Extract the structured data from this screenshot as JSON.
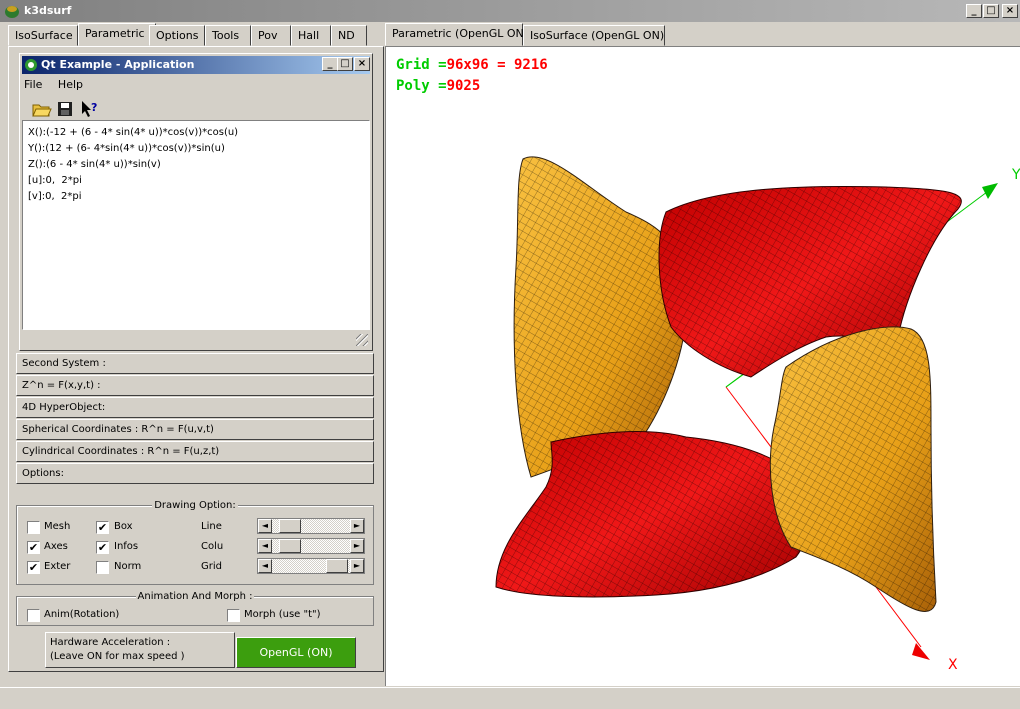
{
  "app": {
    "title": "k3dsurf"
  },
  "left_tabs": [
    "IsoSurface",
    "Parametric",
    "Options",
    "Tools",
    "Pov",
    "Hall",
    "ND"
  ],
  "right_tabs": [
    "Parametric (OpenGL ON)",
    "IsoSurface (OpenGL ON)"
  ],
  "qt_window": {
    "title": "Qt Example - Application",
    "menu": [
      "File",
      "Help"
    ],
    "editor_lines": [
      "X():(-12 + (6 - 4* sin(4* u))*cos(v))*cos(u)",
      "Y():(12 + (6- 4*sin(4* u))*cos(v))*sin(u)",
      "Z():(6 - 4* sin(4* u))*sin(v)",
      "[u]:0,  2*pi",
      "[v]:0,  2*pi"
    ]
  },
  "sections": [
    "Second System :",
    "Z^n = F(x,y,t) :",
    "4D HyperObject:",
    "Spherical Coordinates : R^n = F(u,v,t)",
    "Cylindrical Coordinates : R^n = F(u,z,t)",
    "Options:"
  ],
  "drawing": {
    "title": "Drawing Option:",
    "checks": [
      {
        "label": "Mesh",
        "checked": false
      },
      {
        "label": "Box",
        "checked": true
      },
      {
        "label": "Axes",
        "checked": true
      },
      {
        "label": "Infos",
        "checked": true
      },
      {
        "label": "Exter",
        "checked": true
      },
      {
        "label": "Norm",
        "checked": false
      }
    ],
    "sliders": [
      {
        "label": "Line",
        "position": 0.12
      },
      {
        "label": "Colu",
        "position": 0.12
      },
      {
        "label": "Grid",
        "position": 0.97
      }
    ]
  },
  "animation": {
    "title": "Animation And Morph :",
    "anim_label": "Anim(Rotation)",
    "morph_label": "Morph (use \"t\")",
    "anim_checked": false,
    "morph_checked": false
  },
  "hardware": {
    "label_line1": "Hardware Acceleration :",
    "label_line2": "(Leave ON for max speed )",
    "button": "OpenGL (ON)",
    "button_color": "#3c9e0e"
  },
  "viewport": {
    "grid_label": "Grid =",
    "grid_value": "96x96 = 9216",
    "poly_label": "Poly =",
    "poly_value": "9025",
    "axis_x": "X",
    "axis_y": "Y",
    "colors": {
      "red": "#e01010",
      "gold": "#f0a820",
      "axis_x": "#ff0000",
      "axis_y": "#00cc00"
    }
  }
}
